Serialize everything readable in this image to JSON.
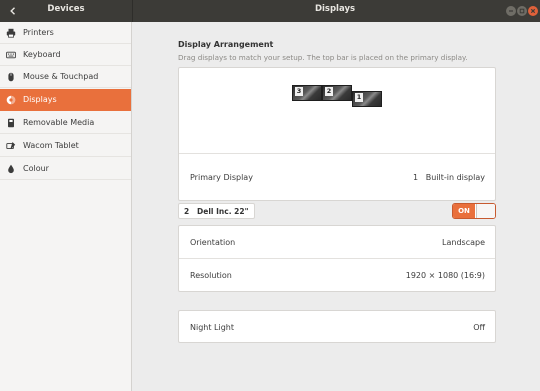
{
  "header": {
    "left_title": "Devices",
    "title": "Displays"
  },
  "sidebar": {
    "items": [
      {
        "label": "Printers",
        "icon": "printer-icon"
      },
      {
        "label": "Keyboard",
        "icon": "keyboard-icon"
      },
      {
        "label": "Mouse & Touchpad",
        "icon": "mouse-icon"
      },
      {
        "label": "Displays",
        "icon": "display-icon",
        "active": true
      },
      {
        "label": "Removable Media",
        "icon": "removable-media-icon"
      },
      {
        "label": "Wacom Tablet",
        "icon": "tablet-icon"
      },
      {
        "label": "Colour",
        "icon": "colour-icon"
      }
    ]
  },
  "main": {
    "section_title": "Display Arrangement",
    "section_subtitle": "Drag displays to match your setup. The top bar is placed on the primary display.",
    "monitors": [
      {
        "number": "3"
      },
      {
        "number": "2"
      },
      {
        "number": "1"
      }
    ],
    "primary_display": {
      "label": "Primary Display",
      "value": "1   Built-in display"
    },
    "monitor_name": "2   Dell Inc. 22\"",
    "toggle_label": "ON",
    "orientation": {
      "label": "Orientation",
      "value": "Landscape"
    },
    "resolution": {
      "label": "Resolution",
      "value": "1920 × 1080 (16:9)"
    },
    "night_light": {
      "label": "Night Light",
      "value": "Off"
    }
  },
  "colors": {
    "accent": "#e9703c",
    "header_bg": "#3c3b37"
  }
}
